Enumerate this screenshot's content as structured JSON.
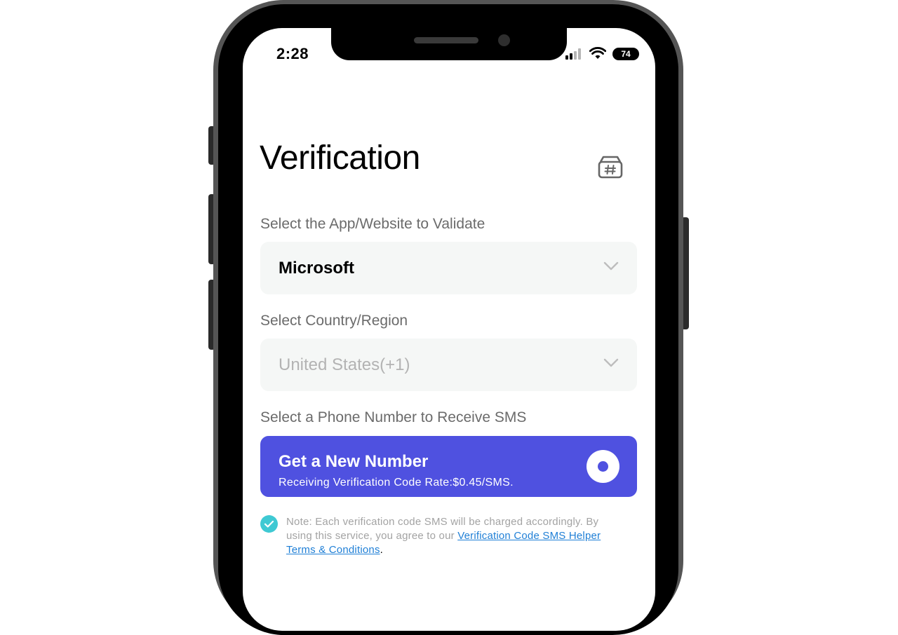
{
  "status_bar": {
    "time": "2:28",
    "battery": "74"
  },
  "page": {
    "title": "Verification"
  },
  "app_select": {
    "label": "Select the App/Website to Validate",
    "value": "Microsoft"
  },
  "country_select": {
    "label": "Select Country/Region",
    "value": "United States(+1)"
  },
  "phone_select": {
    "label": "Select a Phone Number to Receive SMS",
    "option_title": "Get a New Number",
    "option_subtitle": "Receiving Verification Code Rate:$0.45/SMS."
  },
  "note": {
    "text": "Note: Each verification code SMS will be charged accordingly. By using this service, you agree to our ",
    "link": "Verification Code SMS Helper Terms & Conditions",
    "end": "."
  },
  "icons": {
    "header_right": "hash-box-icon",
    "dropdown": "chevron-down-icon",
    "checkbox": "check-circle-icon",
    "radio": "radio-selected-icon"
  },
  "colors": {
    "accent": "#4f51e0",
    "check": "#3fc9d3",
    "link": "#1f7fd6",
    "field_bg": "#f5f7f6"
  }
}
